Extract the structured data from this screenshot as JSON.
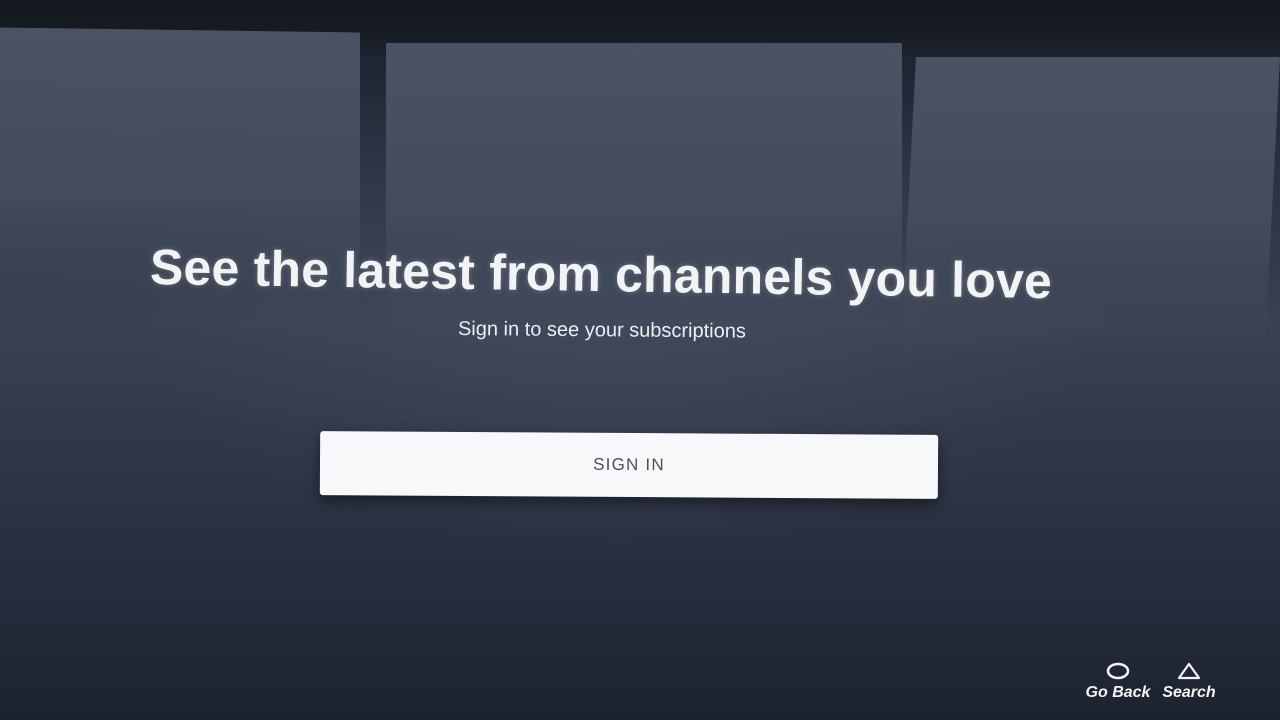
{
  "promo": {
    "headline": "See the latest from channels you love",
    "subline": "Sign in to see your subscriptions",
    "sign_in_label": "SIGN IN"
  },
  "hints": {
    "back": {
      "icon": "circle-icon",
      "label": "Go Back"
    },
    "search": {
      "icon": "triangle-icon",
      "label": "Search"
    }
  },
  "colors": {
    "background": "#2f3646",
    "card": "#474f60",
    "button": "#f7f8fa",
    "button_text": "#4a4f5a",
    "text": "#f2f3f5"
  }
}
